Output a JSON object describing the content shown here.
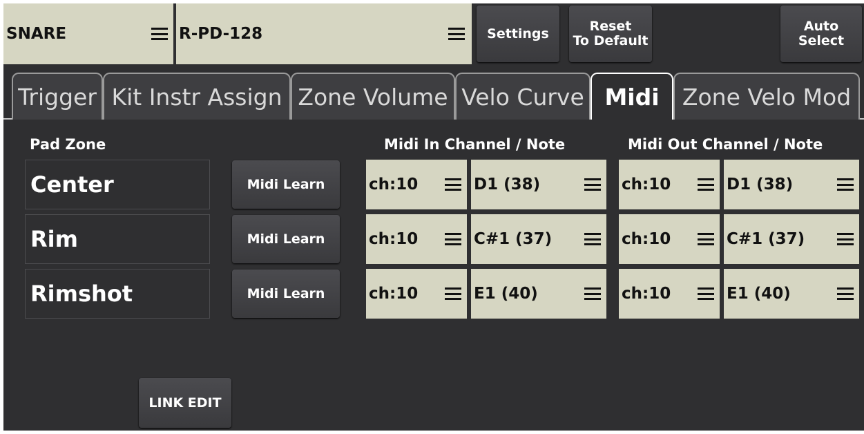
{
  "top": {
    "pad_select": "SNARE",
    "model_select": "R-PD-128",
    "settings": "Settings",
    "reset_line1": "Reset",
    "reset_line2": "To Default",
    "auto_line1": "Auto",
    "auto_line2": "Select"
  },
  "tabs": [
    "Trigger",
    "Kit Instr Assign",
    "Zone Volume",
    "Velo Curve",
    "Midi",
    "Zone Velo Mod"
  ],
  "active_tab": "Midi",
  "headers": {
    "pad_zone": "Pad Zone",
    "midi_in": "Midi In Channel / Note",
    "midi_out": "Midi Out Channel / Note"
  },
  "rows": [
    {
      "zone": "Center",
      "learn": "Midi Learn",
      "in_ch": "ch:10",
      "in_note": "D1 (38)",
      "out_ch": "ch:10",
      "out_note": "D1 (38)"
    },
    {
      "zone": "Rim",
      "learn": "Midi Learn",
      "in_ch": "ch:10",
      "in_note": "C#1 (37)",
      "out_ch": "ch:10",
      "out_note": "C#1 (37)"
    },
    {
      "zone": "Rimshot",
      "learn": "Midi Learn",
      "in_ch": "ch:10",
      "in_note": "E1 (40)",
      "out_ch": "ch:10",
      "out_note": "E1 (40)"
    }
  ],
  "link_edit": "LINK EDIT",
  "icons": {
    "menu": "hamburger-menu-icon"
  },
  "colors": {
    "background": "#2f2f31",
    "selector": "#d6d6c2",
    "button": "#444447",
    "text": "#ffffff"
  }
}
